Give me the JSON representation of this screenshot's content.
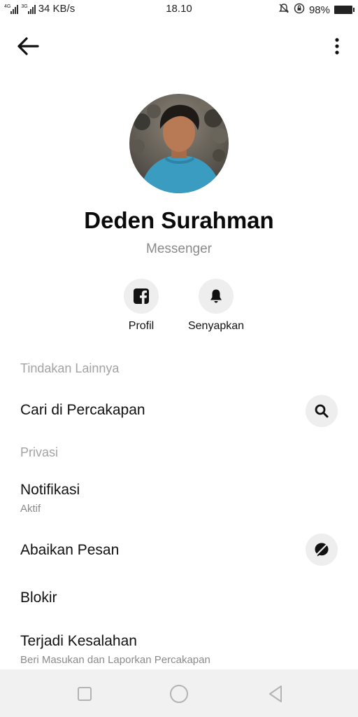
{
  "status_bar": {
    "network_speed": "34 KB/s",
    "time": "18.10",
    "battery": "98%",
    "signal_1_label": "4G",
    "signal_2_label": "3G"
  },
  "top_bar": {
    "back_icon": "arrow-left-icon",
    "more_icon": "vertical-dots-icon"
  },
  "profile": {
    "name": "Deden Surahman",
    "subtitle": "Messenger"
  },
  "actions": [
    {
      "label": "Profil",
      "icon": "facebook-icon"
    },
    {
      "label": "Senyapkan",
      "icon": "bell-icon"
    }
  ],
  "sections": {
    "more_actions": {
      "header": "Tindakan Lainnya",
      "search": {
        "title": "Cari di Percakapan",
        "icon": "search-icon"
      }
    },
    "privacy": {
      "header": "Privasi",
      "notifications": {
        "title": "Notifikasi",
        "subtitle": "Aktif"
      },
      "ignore": {
        "title": "Abaikan Pesan",
        "icon": "ignore-icon"
      },
      "block": {
        "title": "Blokir"
      },
      "report": {
        "title": "Terjadi Kesalahan",
        "subtitle": "Beri Masukan dan Laporkan Percakapan"
      }
    }
  },
  "nav_bar": {
    "recent_icon": "square-icon",
    "home_icon": "circle-icon",
    "back_icon": "triangle-back-icon"
  },
  "colors": {
    "icon_bg": "#eeeeee",
    "secondary_text": "#8a8a8a",
    "section_header": "#a3a3a3",
    "nav_bg": "#f1f1f1"
  }
}
